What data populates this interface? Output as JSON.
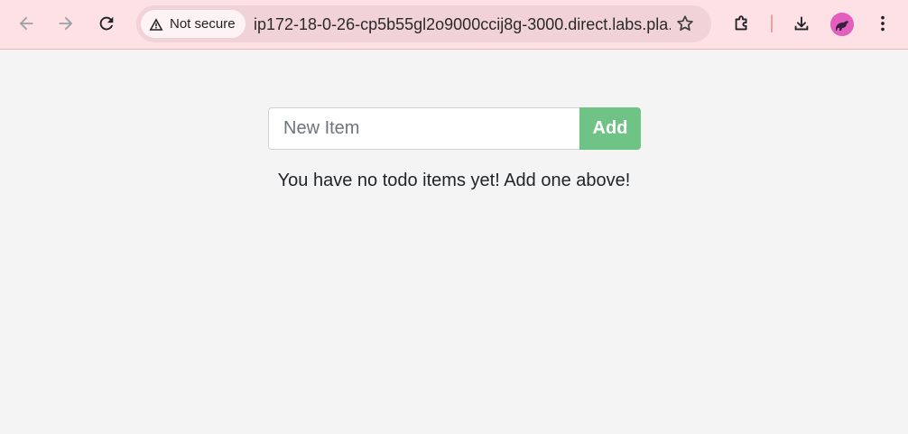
{
  "browser": {
    "back_icon": "arrow-left-icon",
    "forward_icon": "arrow-right-icon",
    "reload_icon": "reload-icon",
    "security_label": "Not secure",
    "url": "ip172-18-0-26-cp5b55gl2o9000ccij8g-3000.direct.labs.pla...",
    "bookmark_icon": "star-icon",
    "extensions_icon": "puzzle-icon",
    "download_icon": "download-icon",
    "menu_icon": "kebab-menu-icon",
    "toolbar_color": "#fde1e4"
  },
  "todo": {
    "input_placeholder": "New Item",
    "input_value": "",
    "add_label": "Add",
    "empty_message": "You have no todo items yet! Add one above!",
    "accent_color": "#6fc384"
  }
}
